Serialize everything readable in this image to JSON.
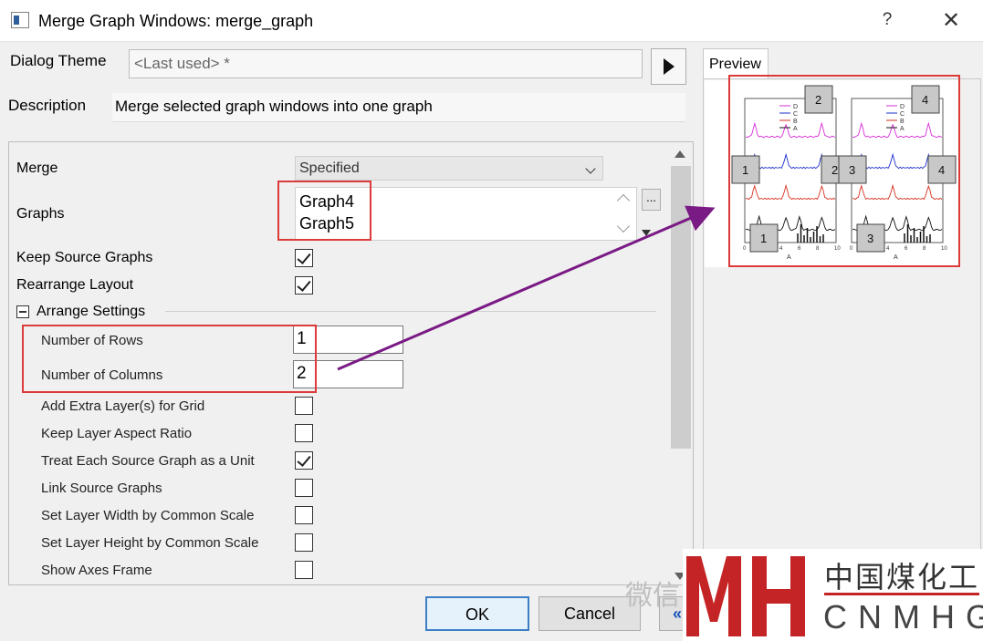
{
  "window": {
    "title": "Merge Graph Windows: merge_graph",
    "help": "?",
    "close": "✕"
  },
  "theme": {
    "label": "Dialog Theme",
    "value": "<Last used> *"
  },
  "description": {
    "label": "Description",
    "value": "Merge selected graph windows into one graph"
  },
  "merge": {
    "label": "Merge",
    "value": "Specified"
  },
  "graphs": {
    "label": "Graphs",
    "items": [
      "Graph4",
      "Graph5"
    ],
    "browse": "..."
  },
  "keep_source": {
    "label": "Keep Source Graphs",
    "checked": true
  },
  "rearrange": {
    "label": "Rearrange Layout",
    "checked": true
  },
  "arrange": {
    "label": "Arrange Settings",
    "rows_label": "Number of Rows",
    "rows": "1",
    "cols_label": "Number of Columns",
    "cols": "2",
    "options": [
      {
        "label": "Add Extra Layer(s) for Grid",
        "checked": false
      },
      {
        "label": "Keep Layer Aspect Ratio",
        "checked": false
      },
      {
        "label": "Treat Each Source Graph as a Unit",
        "checked": true
      },
      {
        "label": "Link Source Graphs",
        "checked": false
      },
      {
        "label": "Set Layer Width by Common Scale",
        "checked": false
      },
      {
        "label": "Set Layer Height by Common Scale",
        "checked": false
      },
      {
        "label": "Show Axes Frame",
        "checked": false
      }
    ]
  },
  "preview": {
    "tab": "Preview",
    "layer_labels": [
      "2",
      "1",
      "2",
      "1",
      "4",
      "3",
      "4",
      "3"
    ],
    "axis_title": "A",
    "ticks": [
      "0",
      "2",
      "4",
      "6",
      "8",
      "10"
    ],
    "legend": [
      "D",
      "C",
      "B",
      "A"
    ],
    "colors": {
      "D": "#d62fd6",
      "C": "#1c2fc9",
      "B": "#d6301f",
      "A": "#111111"
    }
  },
  "buttons": {
    "ok": "OK",
    "cancel": "Cancel",
    "more": "«"
  },
  "watermark": {
    "text": "微信"
  },
  "logo": {
    "cn": "中国煤化工",
    "en": "CNMHG"
  },
  "colors": {
    "highlight": "#dd3a3a",
    "arrow": "#7a1a84",
    "logo_red": "#c52426"
  }
}
